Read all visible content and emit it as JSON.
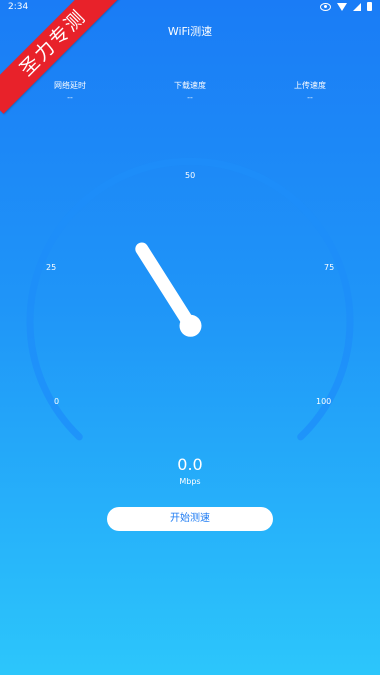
{
  "status_bar": {
    "time": "2:34",
    "icons": [
      "eye-icon",
      "wifi-icon",
      "signal-icon",
      "battery-icon"
    ]
  },
  "ribbon": {
    "text": "圣力专测",
    "color": "#e8222a"
  },
  "header": {
    "title": "WiFi测速"
  },
  "stats": [
    {
      "label": "网络延时",
      "value": "--"
    },
    {
      "label": "下载速度",
      "value": "--"
    },
    {
      "label": "上传速度",
      "value": "--"
    }
  ],
  "gauge": {
    "ticks": [
      "0",
      "25",
      "50",
      "75",
      "100"
    ],
    "needle_value": 38
  },
  "speed": {
    "value": "0.0",
    "unit": "Mbps"
  },
  "actions": {
    "start_label": "开始测速"
  },
  "colors": {
    "background_top": "#1a7cf6",
    "background_bottom": "#2cc6fb",
    "button_text": "#1f7cf3"
  }
}
